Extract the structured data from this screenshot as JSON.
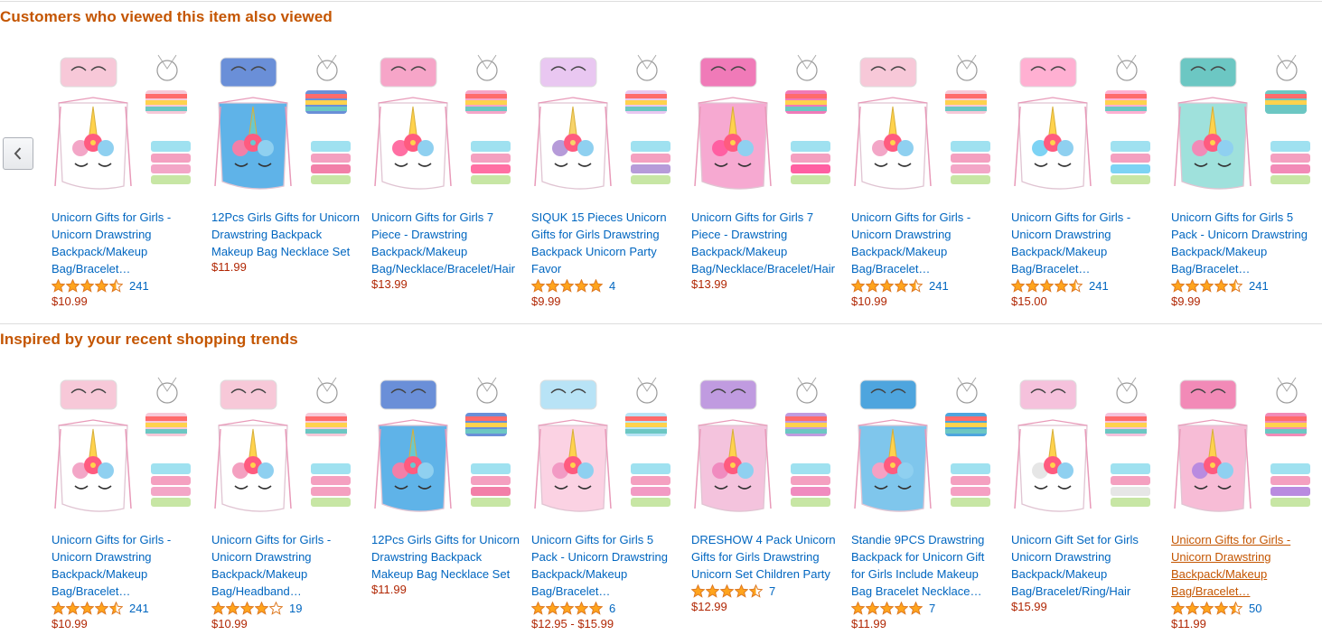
{
  "colors": {
    "section_title": "#c45500",
    "link": "#0066c0",
    "link_hover": "#c45500",
    "price": "#b12704",
    "star": "#ffa41c",
    "divider": "#dddddd"
  },
  "sections": [
    {
      "title": "Customers who viewed this item also viewed",
      "has_prev_button": true,
      "prev_button_icon": "chevron-left-icon",
      "items": [
        {
          "title": "Unicorn Gifts for Girls - Unicorn Drawstring Backpack/Makeup Bag/Bracelet…",
          "rating": 4.5,
          "reviews": "241",
          "price": "$10.99",
          "image_style": "white-unicorn-drawstring"
        },
        {
          "title": "12Pcs Girls Gifts for Unicorn Drawstring Backpack Makeup Bag Necklace Set",
          "rating": null,
          "reviews": "",
          "price": "$11.99",
          "image_style": "blue-pony-backpack"
        },
        {
          "title": "Unicorn Gifts for Girls 7 Piece - Drawstring Backpack/Makeup Bag/Necklace/Bracelet/Hair Ties/Keychain (White…",
          "rating": null,
          "reviews": "",
          "price": "$13.99",
          "image_style": "white-unicorn-7pc"
        },
        {
          "title": "SIQUK 15 Pieces Unicorn Gifts for Girls Drawstring Backpack Unicorn Party Favor",
          "rating": 5,
          "reviews": "4",
          "price": "$9.99",
          "image_style": "white-unicorn-15pc"
        },
        {
          "title": "Unicorn Gifts for Girls 7 Piece - Drawstring Backpack/Makeup Bag/Necklace/Bracelet/Hair Ties/Keychain (Pink…",
          "rating": null,
          "reviews": "",
          "price": "$13.99",
          "image_style": "pink-unicorn-7pc"
        },
        {
          "title": "Unicorn Gifts for Girls - Unicorn Drawstring Backpack/Makeup Bag/Bracelet…",
          "rating": 4.5,
          "reviews": "241",
          "price": "$10.99",
          "image_style": "white-unicorn-drawstring"
        },
        {
          "title": "Unicorn Gifts for Girls - Unicorn Drawstring Backpack/Makeup Bag/Bracelet…",
          "rating": 4.5,
          "reviews": "241",
          "price": "$15.00",
          "image_style": "rainbow-unicorn-drawstring"
        },
        {
          "title": "Unicorn Gifts for Girls 5 Pack - Unicorn Drawstring Backpack/Makeup Bag/Bracelet…",
          "rating": 4.5,
          "reviews": "241",
          "price": "$9.99",
          "image_style": "teal-unicorn-drawstring"
        }
      ]
    },
    {
      "title": "Inspired by your recent shopping trends",
      "has_prev_button": false,
      "items": [
        {
          "title": "Unicorn Gifts for Girls - Unicorn Drawstring Backpack/Makeup Bag/Bracelet…",
          "rating": 4.5,
          "reviews": "241",
          "price": "$10.99",
          "image_style": "white-unicorn-drawstring"
        },
        {
          "title": "Unicorn Gifts for Girls - Unicorn Drawstring Backpack/Makeup Bag/Headband…",
          "rating": 4,
          "reviews": "19",
          "price": "$10.99",
          "image_style": "white-unicorn-headband"
        },
        {
          "title": "12Pcs Girls Gifts for Unicorn Drawstring Backpack Makeup Bag Necklace Set",
          "rating": null,
          "reviews": "",
          "price": "$11.99",
          "image_style": "blue-pony-backpack"
        },
        {
          "title": "Unicorn Gifts for Girls 5 Pack - Unicorn Drawstring Backpack/Makeup Bag/Bracelet…",
          "rating": 5,
          "reviews": "6",
          "price": "$12.95 - $15.99",
          "image_style": "pastel-unicorn-5pc"
        },
        {
          "title": "DRESHOW 4 Pack Unicorn Gifts for Girls Drawstring Unicorn Set Children Party",
          "rating": 4.5,
          "reviews": "7",
          "price": "$12.99",
          "image_style": "purple-unicorn-4pc"
        },
        {
          "title": "Standie 9PCS Drawstring Backpack for Unicorn Gift for Girls Include Makeup Bag Bracelet Necklace…",
          "rating": 5,
          "reviews": "7",
          "price": "$11.99",
          "image_style": "blue-unicorn-9pc"
        },
        {
          "title": "Unicorn Gift Set for Girls Unicorn Drawstring Backpack/Makeup Bag/Bracelet/Ring/Hair tie/Notepad(White)",
          "rating": null,
          "reviews": "",
          "price": "$15.99",
          "image_style": "white-unicorn-notepad"
        },
        {
          "title": "Unicorn Gifts for Girls - Unicorn Drawstring Backpack/Makeup Bag/Bracelet…",
          "rating": 4.5,
          "reviews": "50",
          "price": "$11.99",
          "image_style": "pink-unicorn-drawstring",
          "hovered": true
        }
      ]
    }
  ]
}
